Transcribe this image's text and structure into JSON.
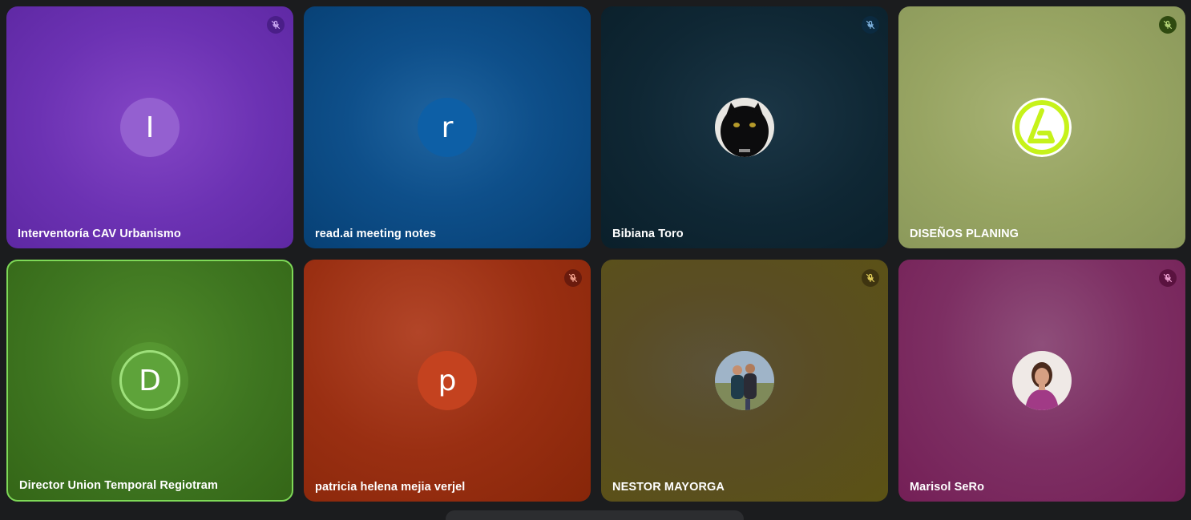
{
  "meeting": {
    "participants": [
      {
        "name": "Interventoría CAV Urbanismo",
        "initial": "I",
        "avatar": "letter",
        "muted": true,
        "speaking": false,
        "color": "#6c32b3"
      },
      {
        "name": "read.ai meeting notes",
        "initial": "r",
        "avatar": "letter",
        "muted": false,
        "speaking": false,
        "color": "#0e4f8a"
      },
      {
        "name": "Bibiana Toro",
        "initial": "",
        "avatar": "photo-black-cat",
        "muted": true,
        "speaking": false,
        "color": "#0f2734"
      },
      {
        "name": "DISEÑOS PLANING",
        "initial": "",
        "avatar": "logo",
        "muted": true,
        "speaking": false,
        "color": "#97a462"
      },
      {
        "name": "Director Union Temporal Regiotram",
        "initial": "D",
        "avatar": "letter",
        "muted": false,
        "speaking": true,
        "color": "#3e7520"
      },
      {
        "name": "patricia helena mejia verjel",
        "initial": "p",
        "avatar": "letter",
        "muted": true,
        "speaking": false,
        "color": "#9a2f12"
      },
      {
        "name": "NESTOR MAYORGA",
        "initial": "",
        "avatar": "photo-couple",
        "muted": true,
        "speaking": false,
        "color": "#5a4d25"
      },
      {
        "name": "Marisol SeRo",
        "initial": "",
        "avatar": "photo-woman",
        "muted": true,
        "speaking": false,
        "color": "#7d2f63"
      }
    ]
  },
  "icons": {
    "mute": "mic-off-icon"
  },
  "colors": {
    "background": "#1b1c1e",
    "speaking_border": "#7ed957",
    "logo_green": "#c6f21a"
  }
}
